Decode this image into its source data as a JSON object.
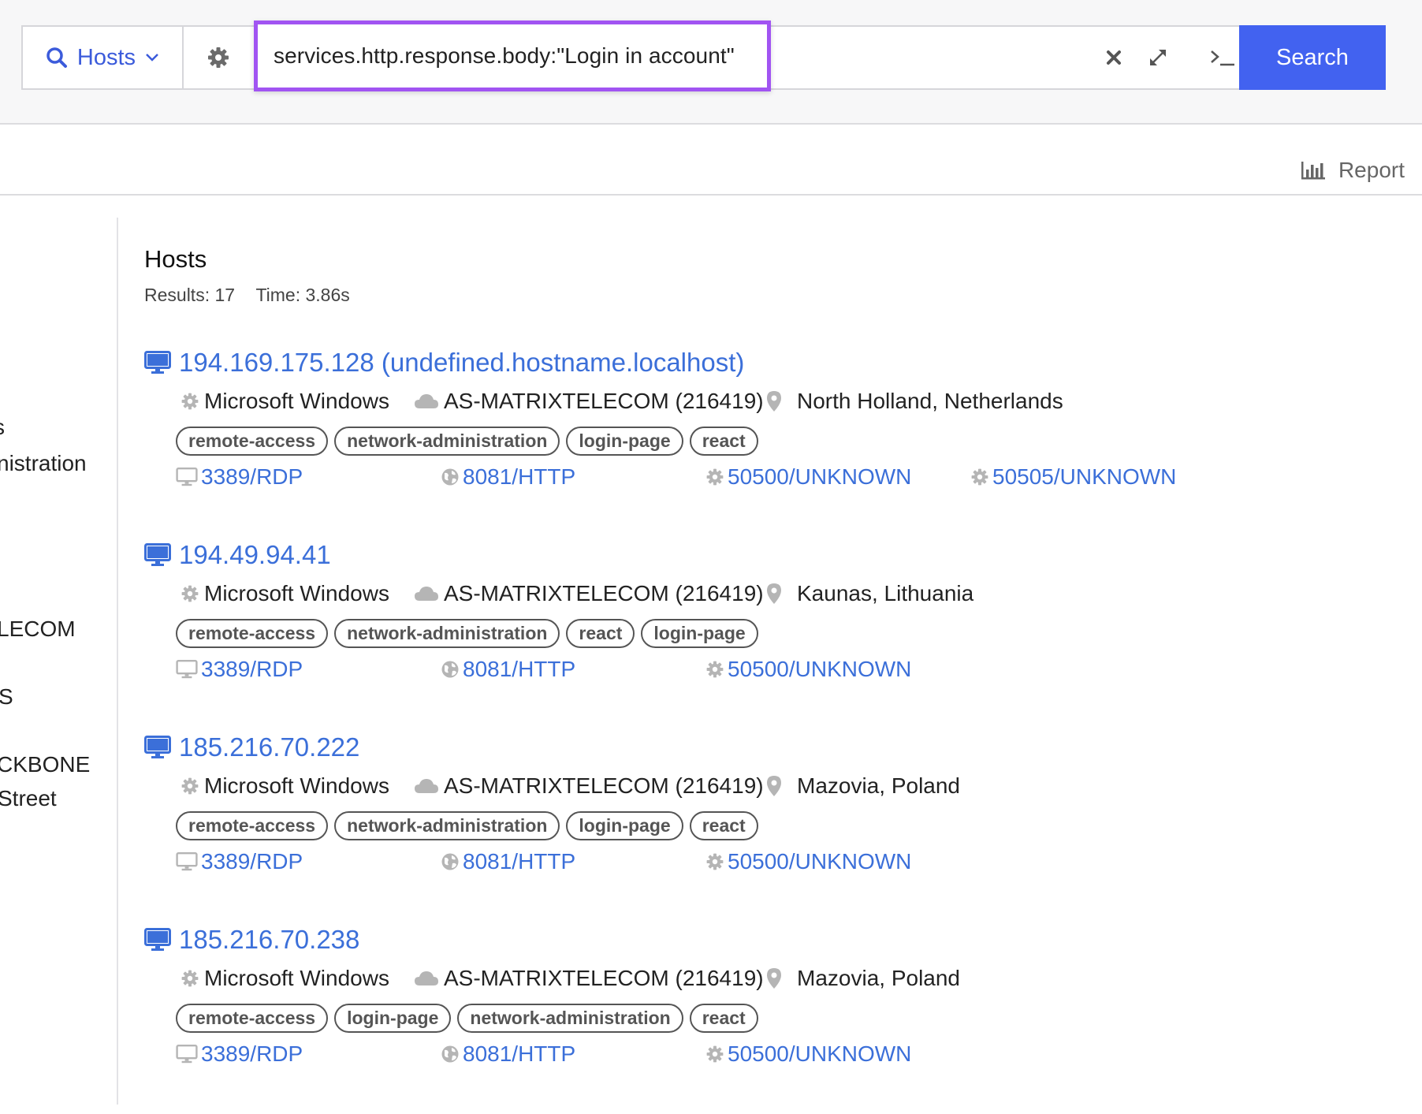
{
  "search": {
    "type_label": "Hosts",
    "query": "services.http.response.body:\"Login in account\"",
    "button_label": "Search"
  },
  "report": {
    "label": "Report"
  },
  "sidebar_fragments": [
    "s",
    "nistration",
    "LECOM",
    "S",
    "CKBONE",
    "Street"
  ],
  "results": {
    "title": "Hosts",
    "count_text": "Results: 17",
    "time_text": "Time: 3.86s"
  },
  "colors": {
    "accent": "#4262f0",
    "link": "#3b6fd9",
    "highlight_border": "#a154f2"
  },
  "hosts": [
    {
      "title": "194.169.175.128 (undefined.hostname.localhost)",
      "os": "Microsoft Windows",
      "asn": "AS-MATRIXTELECOM (216419)",
      "location": "North Holland, Netherlands",
      "tags": [
        "remote-access",
        "network-administration",
        "login-page",
        "react"
      ],
      "ports": [
        "3389/RDP",
        "8081/HTTP",
        "50500/UNKNOWN",
        "50505/UNKNOWN"
      ]
    },
    {
      "title": "194.49.94.41",
      "os": "Microsoft Windows",
      "asn": "AS-MATRIXTELECOM (216419)",
      "location": "Kaunas, Lithuania",
      "tags": [
        "remote-access",
        "network-administration",
        "react",
        "login-page"
      ],
      "ports": [
        "3389/RDP",
        "8081/HTTP",
        "50500/UNKNOWN"
      ]
    },
    {
      "title": "185.216.70.222",
      "os": "Microsoft Windows",
      "asn": "AS-MATRIXTELECOM (216419)",
      "location": "Mazovia, Poland",
      "tags": [
        "remote-access",
        "network-administration",
        "login-page",
        "react"
      ],
      "ports": [
        "3389/RDP",
        "8081/HTTP",
        "50500/UNKNOWN"
      ]
    },
    {
      "title": "185.216.70.238",
      "os": "Microsoft Windows",
      "asn": "AS-MATRIXTELECOM (216419)",
      "location": "Mazovia, Poland",
      "tags": [
        "remote-access",
        "login-page",
        "network-administration",
        "react"
      ],
      "ports": [
        "3389/RDP",
        "8081/HTTP",
        "50500/UNKNOWN"
      ]
    }
  ]
}
